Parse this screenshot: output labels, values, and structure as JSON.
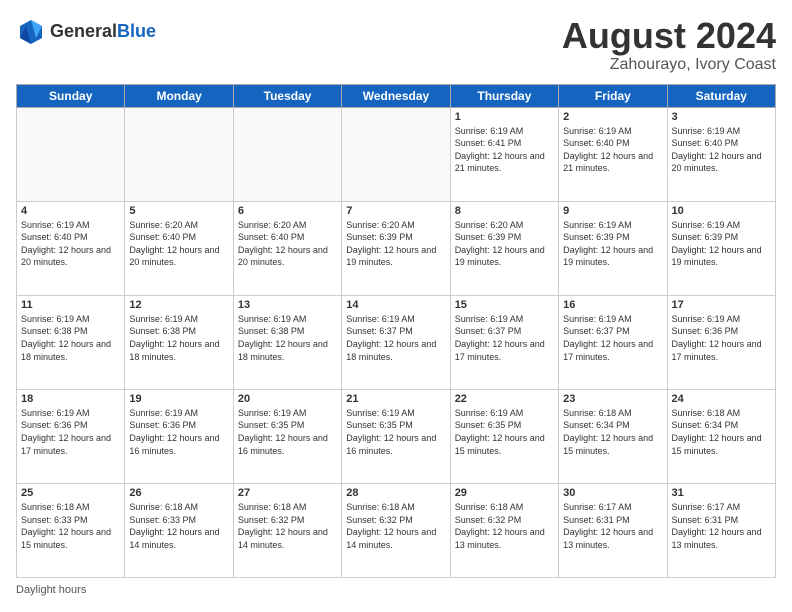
{
  "header": {
    "logo_general": "General",
    "logo_blue": "Blue",
    "title": "August 2024",
    "location": "Zahourayo, Ivory Coast"
  },
  "footer": {
    "label": "Daylight hours"
  },
  "weekdays": [
    "Sunday",
    "Monday",
    "Tuesday",
    "Wednesday",
    "Thursday",
    "Friday",
    "Saturday"
  ],
  "weeks": [
    [
      {
        "day": "",
        "info": ""
      },
      {
        "day": "",
        "info": ""
      },
      {
        "day": "",
        "info": ""
      },
      {
        "day": "",
        "info": ""
      },
      {
        "day": "1",
        "info": "Sunrise: 6:19 AM\nSunset: 6:41 PM\nDaylight: 12 hours and 21 minutes."
      },
      {
        "day": "2",
        "info": "Sunrise: 6:19 AM\nSunset: 6:40 PM\nDaylight: 12 hours and 21 minutes."
      },
      {
        "day": "3",
        "info": "Sunrise: 6:19 AM\nSunset: 6:40 PM\nDaylight: 12 hours and 20 minutes."
      }
    ],
    [
      {
        "day": "4",
        "info": "Sunrise: 6:19 AM\nSunset: 6:40 PM\nDaylight: 12 hours and 20 minutes."
      },
      {
        "day": "5",
        "info": "Sunrise: 6:20 AM\nSunset: 6:40 PM\nDaylight: 12 hours and 20 minutes."
      },
      {
        "day": "6",
        "info": "Sunrise: 6:20 AM\nSunset: 6:40 PM\nDaylight: 12 hours and 20 minutes."
      },
      {
        "day": "7",
        "info": "Sunrise: 6:20 AM\nSunset: 6:39 PM\nDaylight: 12 hours and 19 minutes."
      },
      {
        "day": "8",
        "info": "Sunrise: 6:20 AM\nSunset: 6:39 PM\nDaylight: 12 hours and 19 minutes."
      },
      {
        "day": "9",
        "info": "Sunrise: 6:19 AM\nSunset: 6:39 PM\nDaylight: 12 hours and 19 minutes."
      },
      {
        "day": "10",
        "info": "Sunrise: 6:19 AM\nSunset: 6:39 PM\nDaylight: 12 hours and 19 minutes."
      }
    ],
    [
      {
        "day": "11",
        "info": "Sunrise: 6:19 AM\nSunset: 6:38 PM\nDaylight: 12 hours and 18 minutes."
      },
      {
        "day": "12",
        "info": "Sunrise: 6:19 AM\nSunset: 6:38 PM\nDaylight: 12 hours and 18 minutes."
      },
      {
        "day": "13",
        "info": "Sunrise: 6:19 AM\nSunset: 6:38 PM\nDaylight: 12 hours and 18 minutes."
      },
      {
        "day": "14",
        "info": "Sunrise: 6:19 AM\nSunset: 6:37 PM\nDaylight: 12 hours and 18 minutes."
      },
      {
        "day": "15",
        "info": "Sunrise: 6:19 AM\nSunset: 6:37 PM\nDaylight: 12 hours and 17 minutes."
      },
      {
        "day": "16",
        "info": "Sunrise: 6:19 AM\nSunset: 6:37 PM\nDaylight: 12 hours and 17 minutes."
      },
      {
        "day": "17",
        "info": "Sunrise: 6:19 AM\nSunset: 6:36 PM\nDaylight: 12 hours and 17 minutes."
      }
    ],
    [
      {
        "day": "18",
        "info": "Sunrise: 6:19 AM\nSunset: 6:36 PM\nDaylight: 12 hours and 17 minutes."
      },
      {
        "day": "19",
        "info": "Sunrise: 6:19 AM\nSunset: 6:36 PM\nDaylight: 12 hours and 16 minutes."
      },
      {
        "day": "20",
        "info": "Sunrise: 6:19 AM\nSunset: 6:35 PM\nDaylight: 12 hours and 16 minutes."
      },
      {
        "day": "21",
        "info": "Sunrise: 6:19 AM\nSunset: 6:35 PM\nDaylight: 12 hours and 16 minutes."
      },
      {
        "day": "22",
        "info": "Sunrise: 6:19 AM\nSunset: 6:35 PM\nDaylight: 12 hours and 15 minutes."
      },
      {
        "day": "23",
        "info": "Sunrise: 6:18 AM\nSunset: 6:34 PM\nDaylight: 12 hours and 15 minutes."
      },
      {
        "day": "24",
        "info": "Sunrise: 6:18 AM\nSunset: 6:34 PM\nDaylight: 12 hours and 15 minutes."
      }
    ],
    [
      {
        "day": "25",
        "info": "Sunrise: 6:18 AM\nSunset: 6:33 PM\nDaylight: 12 hours and 15 minutes."
      },
      {
        "day": "26",
        "info": "Sunrise: 6:18 AM\nSunset: 6:33 PM\nDaylight: 12 hours and 14 minutes."
      },
      {
        "day": "27",
        "info": "Sunrise: 6:18 AM\nSunset: 6:32 PM\nDaylight: 12 hours and 14 minutes."
      },
      {
        "day": "28",
        "info": "Sunrise: 6:18 AM\nSunset: 6:32 PM\nDaylight: 12 hours and 14 minutes."
      },
      {
        "day": "29",
        "info": "Sunrise: 6:18 AM\nSunset: 6:32 PM\nDaylight: 12 hours and 13 minutes."
      },
      {
        "day": "30",
        "info": "Sunrise: 6:17 AM\nSunset: 6:31 PM\nDaylight: 12 hours and 13 minutes."
      },
      {
        "day": "31",
        "info": "Sunrise: 6:17 AM\nSunset: 6:31 PM\nDaylight: 12 hours and 13 minutes."
      }
    ]
  ]
}
